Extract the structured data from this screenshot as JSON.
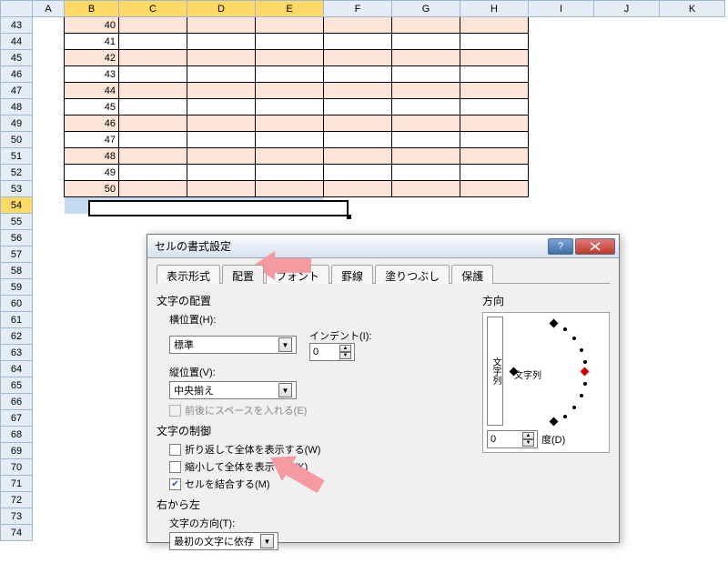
{
  "columns": [
    "A",
    "B",
    "C",
    "D",
    "E",
    "F",
    "G",
    "H",
    "I",
    "J",
    "K"
  ],
  "rows": [
    43,
    44,
    45,
    46,
    47,
    48,
    49,
    50,
    51,
    52,
    53,
    54,
    55,
    56,
    57,
    58,
    59,
    60,
    61,
    62,
    63,
    64,
    65,
    66,
    67,
    68,
    69,
    70,
    71,
    72,
    73,
    74
  ],
  "col_b_values": {
    "43": "40",
    "44": "41",
    "45": "42",
    "46": "43",
    "47": "44",
    "48": "45",
    "49": "46",
    "50": "47",
    "51": "48",
    "52": "49",
    "53": "50"
  },
  "shaded_rows": [
    43,
    45,
    47,
    49,
    51,
    53
  ],
  "selected_row": 54,
  "bordered_cols": [
    "B",
    "C",
    "D",
    "E",
    "F",
    "G",
    "H"
  ],
  "dialog": {
    "title": "セルの書式設定",
    "tabs": [
      "表示形式",
      "配置",
      "フォント",
      "罫線",
      "塗りつぶし",
      "保護"
    ],
    "active_tab": 1,
    "align": {
      "group_text": "文字の配置",
      "h_label": "横位置(H):",
      "h_value": "標準",
      "indent_label": "インデント(I):",
      "indent_value": "0",
      "v_label": "縦位置(V):",
      "v_value": "中央揃え",
      "justify_label": "前後にスペースを入れる(E)"
    },
    "control": {
      "group_text": "文字の制御",
      "wrap": "折り返して全体を表示する(W)",
      "shrink": "縮小して全体を表示する(K)",
      "merge": "セルを結合する(M)",
      "merge_checked": true
    },
    "rtl": {
      "group_text": "右から左",
      "dir_label": "文字の方向(T):",
      "dir_value": "最初の文字に依存"
    },
    "orient": {
      "group_text": "方向",
      "vert_text": "文字列",
      "hlabel": "文字列",
      "deg_value": "0",
      "deg_label": "度(D)"
    }
  }
}
